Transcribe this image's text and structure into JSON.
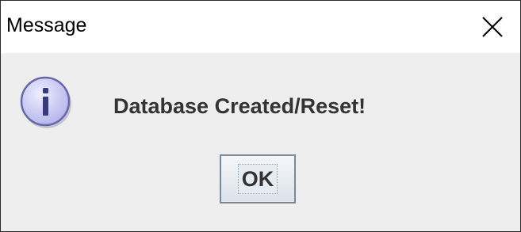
{
  "window": {
    "title": "Message"
  },
  "dialog": {
    "icon": "info-icon",
    "message": "Database Created/Reset!",
    "ok_label": "OK"
  },
  "colors": {
    "titlebar_bg": "#ffffff",
    "dialog_bg": "#eeeeee",
    "icon_fill": "#c8c8f8",
    "icon_stroke": "#6666aa",
    "text": "#333333"
  }
}
